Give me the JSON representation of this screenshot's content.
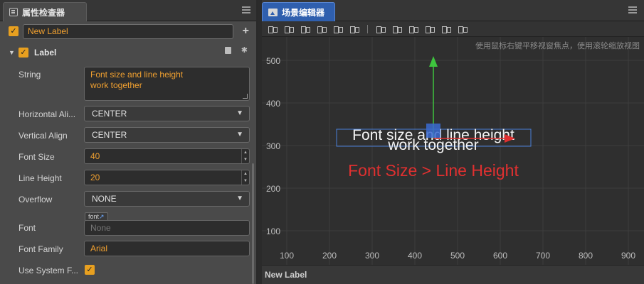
{
  "inspector": {
    "tab_title": "属性检查器",
    "node": {
      "enabled": true,
      "name": "New Label"
    },
    "component": {
      "title": "Label",
      "enabled": true
    },
    "props": {
      "string_label": "String",
      "string_value_line1": "Font size and line height",
      "string_value_line2": "work together",
      "h_align_label": "Horizontal Ali...",
      "h_align_value": "CENTER",
      "v_align_label": "Vertical Align",
      "v_align_value": "CENTER",
      "font_size_label": "Font Size",
      "font_size_value": "40",
      "line_height_label": "Line Height",
      "line_height_value": "20",
      "overflow_label": "Overflow",
      "overflow_value": "NONE",
      "font_label": "Font",
      "font_tag": "font",
      "font_placeholder": "None",
      "font_family_label": "Font Family",
      "font_family_value": "Arial",
      "system_font_label": "Use System F...",
      "system_font_checked": true
    }
  },
  "scene": {
    "tab_title": "场景编辑器",
    "hint": "使用鼠标右键平移视窗焦点，使用滚轮缩放视图",
    "y_ticks": [
      "500",
      "400",
      "300",
      "200",
      "100"
    ],
    "x_ticks": [
      "100",
      "200",
      "300",
      "400",
      "500",
      "600",
      "700",
      "800",
      "900"
    ],
    "label_text_line1": "Font size and line height",
    "label_text_line2": "work together",
    "annotation": "Font Size > Line Height",
    "status_node": "New Label"
  },
  "colors": {
    "accent_orange": "#e8a020",
    "selection_blue": "#2f5fae",
    "annotation_red": "#e03030",
    "gizmo_green": "#3ec43e"
  }
}
